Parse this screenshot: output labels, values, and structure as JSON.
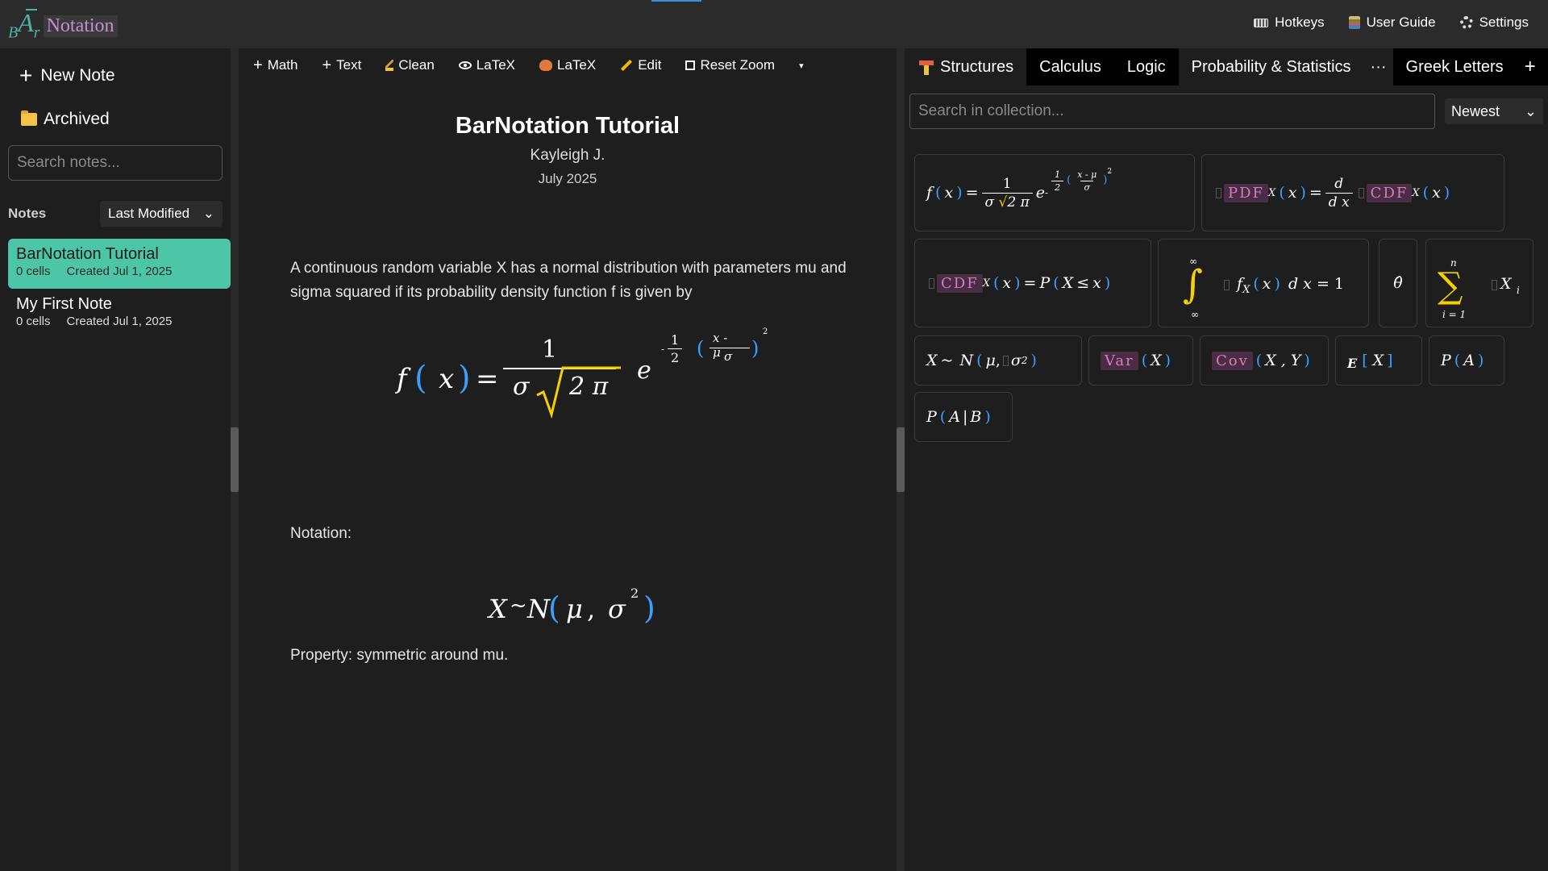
{
  "app": {
    "logo_mark": "BĀr",
    "logo_name": "Notation"
  },
  "header": {
    "hotkeys_label": "Hotkeys",
    "guide_label": "User Guide",
    "settings_label": "Settings"
  },
  "sidebar": {
    "new_note_label": "New Note",
    "archived_label": "Archived",
    "search_placeholder": "Search notes...",
    "notes_label": "Notes",
    "sort_value": "Last Modified",
    "notes": [
      {
        "title": "BarNotation Tutorial",
        "cells": "0 cells",
        "created": "Created Jul 1, 2025",
        "active": true
      },
      {
        "title": "My First Note",
        "cells": "0 cells",
        "created": "Created Jul 1, 2025",
        "active": false
      }
    ]
  },
  "toolbar": {
    "math_label": "Math",
    "text_label": "Text",
    "clean_label": "Clean",
    "latex_view_label": "LaTeX",
    "latex_export_label": "LaTeX",
    "edit_label": "Edit",
    "reset_zoom_label": "Reset Zoom"
  },
  "document": {
    "title": "BarNotation Tutorial",
    "author": "Kayleigh J.",
    "date": "July 2025",
    "paragraph1": "A continuous random variable X has a normal distribution with parameters mu and sigma squared if its probability density function f is given by",
    "notation_label": "Notation:",
    "property_text": "Property: symmetric around mu.",
    "eq1": {
      "lhs": "f",
      "var": "x",
      "numerator": "1",
      "sigma": "σ",
      "radicand": "2 π",
      "exp_base": "e",
      "exp_sign": "-",
      "half_num": "1",
      "half_den": "2",
      "inner_num": "x - μ",
      "inner_den": "σ",
      "outer_power": "2"
    },
    "eq2": {
      "var": "X",
      "tilde": "~",
      "dist": "N",
      "mu": "μ",
      "comma": ",",
      "sigma": "σ",
      "power": "2"
    }
  },
  "panel": {
    "tabs": [
      {
        "label": "Structures",
        "active": true
      },
      {
        "label": "Calculus",
        "active": false
      },
      {
        "label": "Logic",
        "active": false
      },
      {
        "label": "Probability & Statistics",
        "active": true
      },
      {
        "label": "···",
        "active": false
      },
      {
        "label": "Greek Letters",
        "active": false
      },
      {
        "label": "+",
        "active": false
      }
    ],
    "search_placeholder": "Search in collection...",
    "sort_value": "Newest",
    "cards": {
      "pdf_normal": {
        "lhs": "f",
        "var": "x",
        "num": "1",
        "sigma": "σ",
        "radicand": "2 π",
        "e": "e",
        "minus": "-",
        "h_num": "1",
        "h_den": "2",
        "i_num": "x - μ",
        "i_den": "σ",
        "pow": "2"
      },
      "pdf_deriv": {
        "pdf": "PDF",
        "sub": "X",
        "var": "x",
        "d": "d",
        "dx": "d x",
        "cdf": "CDF",
        "sub2": "X",
        "var2": "x"
      },
      "cdf_def": {
        "cdf": "CDF",
        "sub": "X",
        "var": "x",
        "rhs_p": "P",
        "rhs_x": "X",
        "leq": "≤",
        "rhs_var": "x"
      },
      "integral": {
        "upper": "∞",
        "lower": "∞",
        "f": "f",
        "sub": "X",
        "var": "x",
        "dx": "d x",
        "eq": "= 1"
      },
      "theta_hat": {
        "text": "θ̂"
      },
      "summation": {
        "upper": "n",
        "lower": "i = 1",
        "x": "X",
        "sub": "i"
      },
      "dist": {
        "x": "X",
        "tilde": "~",
        "n": "N",
        "mu": "μ",
        "sigma": "σ",
        "pow": "2"
      },
      "var": {
        "pill": "Var",
        "arg": "X"
      },
      "cov": {
        "pill": "Cov",
        "arg": "X , Y"
      },
      "expect": {
        "e": "E",
        "arg": "X"
      },
      "prob": {
        "p": "P",
        "arg": "A"
      },
      "cond": {
        "p": "P",
        "a": "A",
        "bar": "|",
        "b": "B"
      }
    }
  }
}
